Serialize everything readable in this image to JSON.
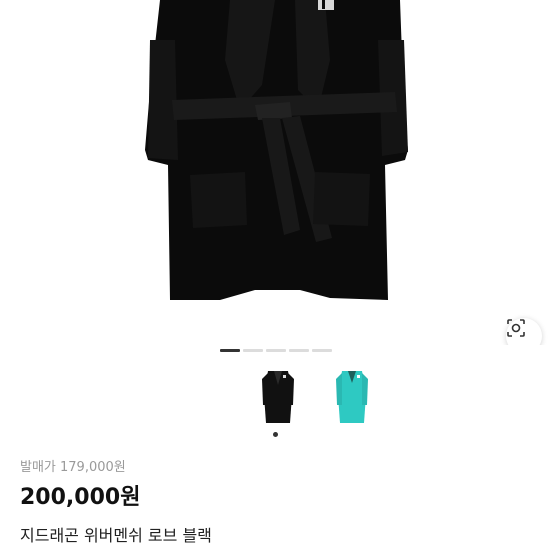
{
  "product": {
    "original_price": "발매가 179,000원",
    "price": "200,000원",
    "title": "지드래곤 위버멘쉬 로브 블랙"
  },
  "gallery": {
    "page_count": 5,
    "active_page": 1,
    "thumbnails": [
      {
        "icon": "black-robe-thumbnail",
        "color": "#111111"
      },
      {
        "icon": "mint-robe-thumbnail",
        "color": "#2ec9c2"
      }
    ],
    "selected_thumbnail": 1
  },
  "colors": {
    "robe": "#0c0c0c",
    "text_primary": "#111111",
    "text_muted": "#9a9a9a"
  },
  "icons": {
    "lens": "lens-search-icon"
  }
}
